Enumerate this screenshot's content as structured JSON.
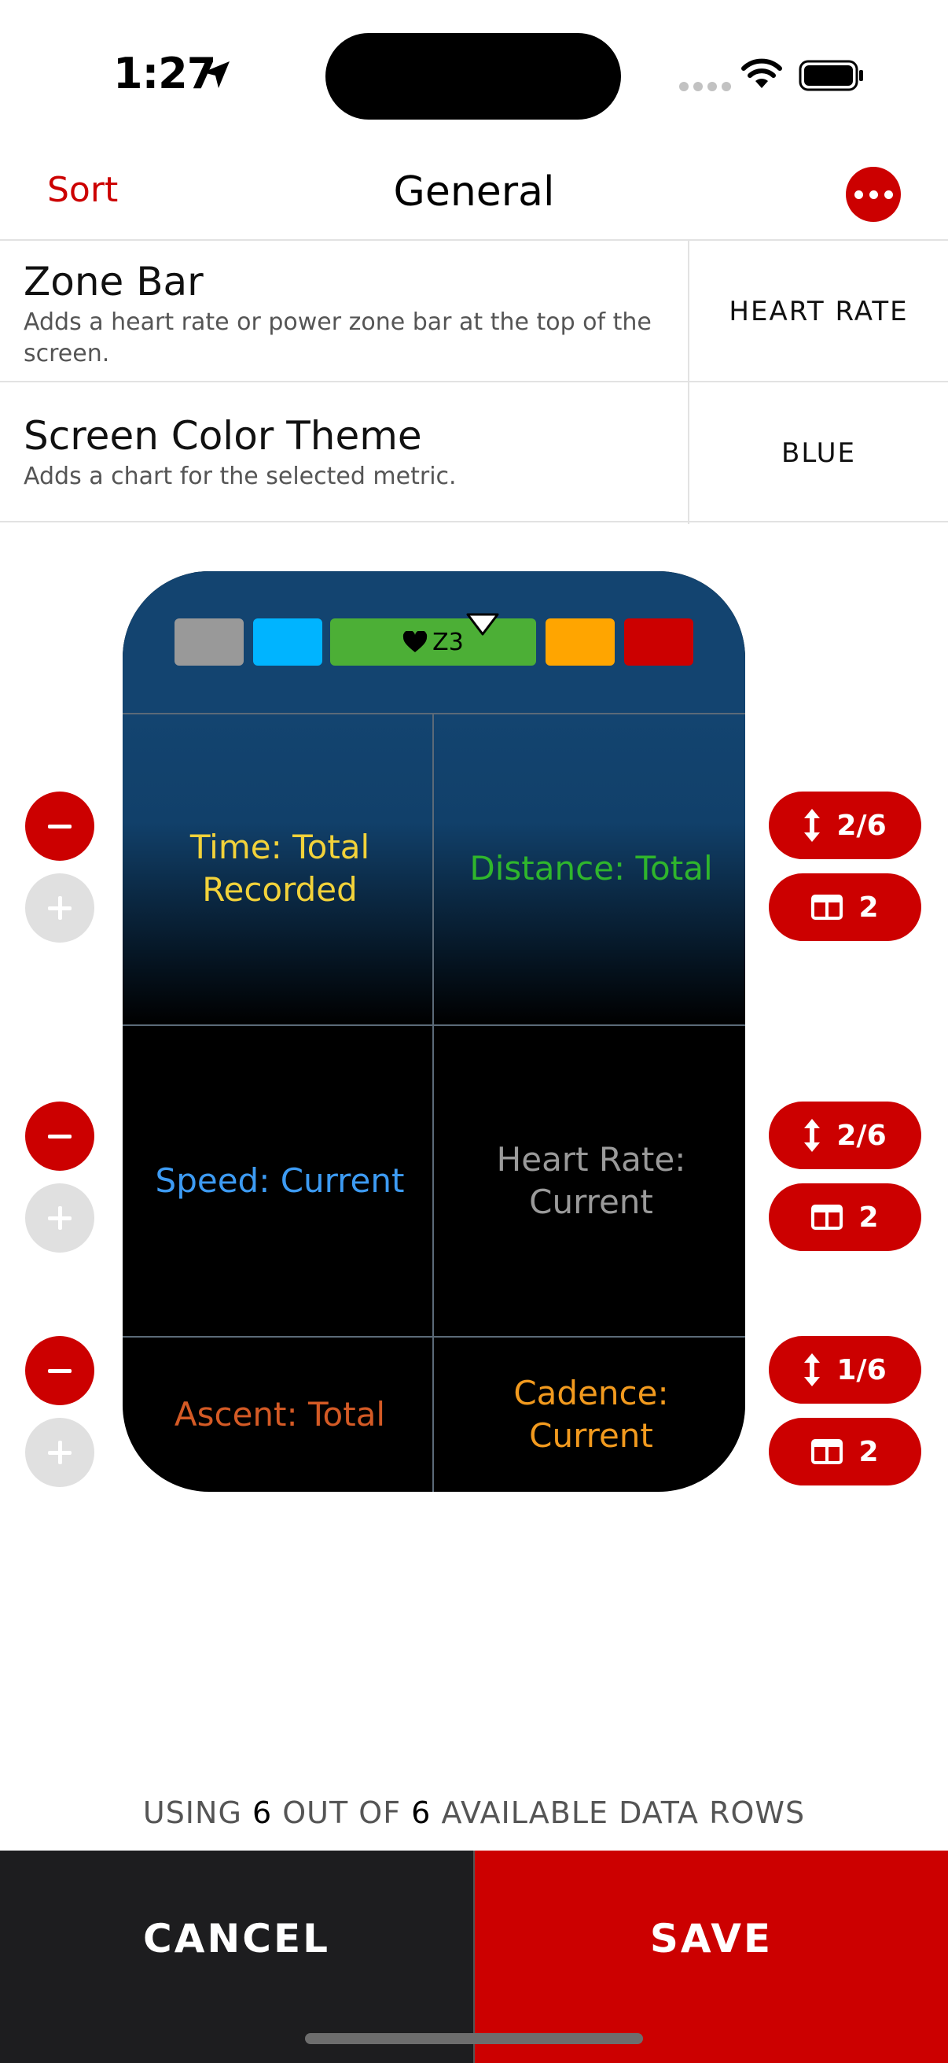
{
  "status_bar": {
    "time": "1:27"
  },
  "nav": {
    "sort_label": "Sort",
    "title": "General",
    "more_icon": "ellipsis-icon"
  },
  "settings": [
    {
      "title": "Zone Bar",
      "description": "Adds a heart rate or power zone bar at the top of the screen.",
      "value": "HEART RATE"
    },
    {
      "title": "Screen Color Theme",
      "description": "Adds a chart for the selected metric.",
      "value": "BLUE"
    }
  ],
  "zone_bar": {
    "label": "Z3",
    "icon": "heart-icon",
    "colors": [
      "#999999",
      "#00b4ff",
      "#4caf36",
      "#ffa500",
      "#cc0000"
    ]
  },
  "rows": [
    {
      "height": "2/6",
      "columns": "2",
      "cells": [
        {
          "label": "Time: Total Recorded",
          "color": "#f2d23a"
        },
        {
          "label": "Distance: Total",
          "color": "#2fb62c"
        }
      ]
    },
    {
      "height": "2/6",
      "columns": "2",
      "cells": [
        {
          "label": "Speed: Current",
          "color": "#3d9bf3"
        },
        {
          "label": "Heart Rate: Current",
          "color": "#9a9a9a"
        }
      ]
    },
    {
      "height": "1/6",
      "columns": "2",
      "cells": [
        {
          "label": "Ascent: Total",
          "color": "#d45a25"
        },
        {
          "label": "Cadence: Current",
          "color": "#f29a1e"
        }
      ]
    }
  ],
  "usage": {
    "prefix": "USING",
    "used": "6",
    "middle": "OUT OF",
    "total": "6",
    "suffix": "AVAILABLE DATA ROWS"
  },
  "footer": {
    "cancel_label": "CANCEL",
    "save_label": "SAVE"
  },
  "colors": {
    "accent": "#cc0000",
    "theme_blue": "#134470"
  }
}
